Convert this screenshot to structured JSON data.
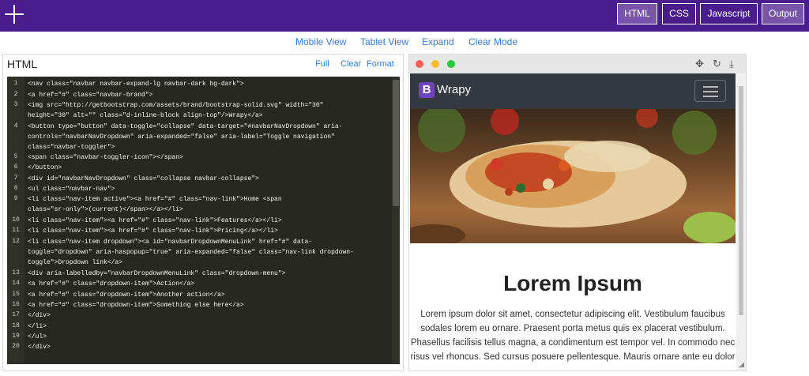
{
  "topbar": {
    "buttons": [
      {
        "label": "HTML",
        "active": true
      },
      {
        "label": "CSS",
        "active": false
      },
      {
        "label": "Javascript",
        "active": false
      },
      {
        "label": "Output",
        "active": true
      }
    ]
  },
  "views": [
    "Mobile View",
    "Tablet View",
    "Expand",
    "Clear Mode"
  ],
  "editor": {
    "title": "HTML",
    "actions": [
      "Full",
      "Clear",
      "Format"
    ],
    "line_numbers": [
      "1",
      "2",
      "3",
      "4",
      "5",
      "6",
      "7",
      "8",
      "9",
      "10",
      "11",
      "12",
      "13",
      "14",
      "15",
      "16",
      "17",
      "18",
      "19",
      "20"
    ],
    "lines": [
      "<nav class=\"navbar navbar-expand-lg navbar-dark bg-dark\">",
      "  <a href=\"#\" class=\"navbar-brand\">",
      "    <img src=\"http://getbootstrap.com/assets/brand/bootstrap-solid.svg\" width=\"30\"",
      "height=\"30\" alt=\"\" class=\"d-inline-block align-top\"/>Wrapy</a>",
      "  <button type=\"button\" data-toggle=\"collapse\" data-target=\"#navbarNavDropdown\" aria-",
      "controls=\"navbarNavDropdown\" aria-expanded=\"false\" aria-label=\"Toggle navigation\"",
      "class=\"navbar-toggler\">",
      "    <span class=\"navbar-toggler-icon\"></span>",
      "  </button>",
      "  <div id=\"navbarNavDropdown\" class=\"collapse navbar-collapse\">",
      "    <ul class=\"navbar-nav\">",
      "      <li class=\"nav-item active\"><a href=\"#\" class=\"nav-link\">Home <span",
      "class=\"sr-only\">(current)</span></a></li>",
      "      <li class=\"nav-item\"><a href=\"#\" class=\"nav-link\">Features</a></li>",
      "      <li class=\"nav-item\"><a href=\"#\" class=\"nav-link\">Pricing</a></li>",
      "      <li class=\"nav-item dropdown\"><a id=\"navbarDropdownMenuLink\" href=\"#\" data-",
      "toggle=\"dropdown\" aria-haspopup=\"true\" aria-expanded=\"false\" class=\"nav-link dropdown-",
      "toggle\">Dropdown link</a>",
      "        <div aria-labelledby=\"navbarDropdownMenuLink\" class=\"dropdown-menu\">",
      "          <a href=\"#\" class=\"dropdown-item\">Action</a>",
      "          <a href=\"#\" class=\"dropdown-item\">Another action</a>",
      "          <a href=\"#\" class=\"dropdown-item\">Something else here</a>",
      "        </div>",
      "      </li>",
      "    </ul>",
      "  </div>"
    ]
  },
  "preview": {
    "chrome_icons": [
      "move-icon",
      "reload-icon",
      "download-icon"
    ],
    "brand_logo": "B",
    "brand": "Wrapy",
    "title": "Lorem Ipsum",
    "text": "Lorem ipsum dolor sit amet, consectetur adipiscing elit. Vestibulum faucibus sodales lorem eu ornare. Praesent porta metus quis ex placerat vestibulum. Phasellus facilisis tellus magna, a condimentum est tempor vel. In commodo nec risus vel rhoncus. Sed cursus posuere pellentesque. Mauris ornare ante eu dolor"
  },
  "colors": {
    "topbar": "#4b1d8c",
    "link": "#3a7bd5",
    "editor_bg": "#272822",
    "navbar": "#343a40",
    "brand_logo": "#6f42c1"
  }
}
